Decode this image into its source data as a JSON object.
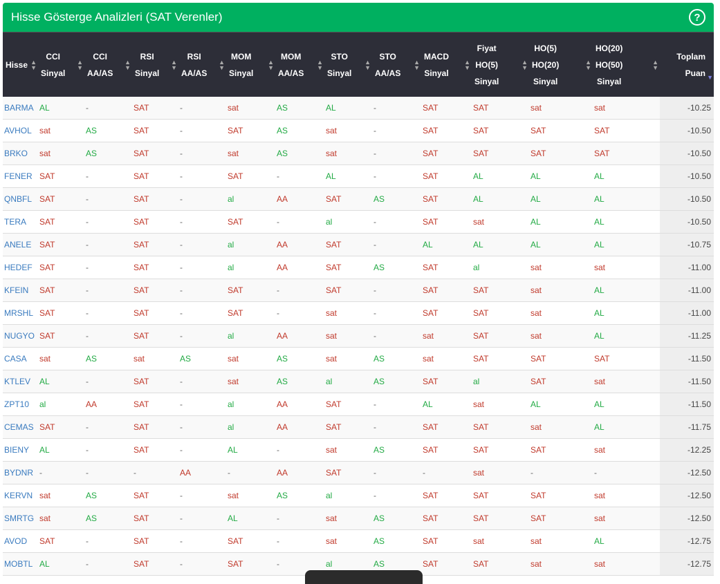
{
  "title": "Hisse Gösterge Analizleri (SAT Verenler)",
  "help_icon": "question-circle-icon",
  "colors": {
    "header_bar": "#00b060",
    "table_header": "#2d2e38",
    "buy": "#22aa44",
    "sell": "#c0392b",
    "stock_link": "#3a7bbf"
  },
  "columns": [
    [
      "Hisse"
    ],
    [
      "CCI",
      "Sinyal"
    ],
    [
      "CCI",
      "AA/AS"
    ],
    [
      "RSI",
      "Sinyal"
    ],
    [
      "RSI",
      "AA/AS"
    ],
    [
      "MOM",
      "Sinyal"
    ],
    [
      "MOM",
      "AA/AS"
    ],
    [
      "STO",
      "Sinyal"
    ],
    [
      "STO",
      "AA/AS"
    ],
    [
      "MACD",
      "Sinyal"
    ],
    [
      "Fiyat",
      "HO(5)",
      "Sinyal"
    ],
    [
      "HO(5)",
      "HO(20)",
      "Sinyal"
    ],
    [
      "HO(20)",
      "HO(50)",
      "Sinyal"
    ],
    [
      "Toplam",
      "Puan"
    ]
  ],
  "sorted_column": "Toplam Puan",
  "sort_direction": "descending",
  "rows": [
    [
      "BARMA",
      "AL",
      "-",
      "SAT",
      "-",
      "sat",
      "AS",
      "AL",
      "-",
      "SAT",
      "SAT",
      "sat",
      "sat",
      "-10.25"
    ],
    [
      "AVHOL",
      "sat",
      "AS",
      "SAT",
      "-",
      "SAT",
      "AS",
      "sat",
      "-",
      "SAT",
      "SAT",
      "SAT",
      "SAT",
      "-10.50"
    ],
    [
      "BRKO",
      "sat",
      "AS",
      "SAT",
      "-",
      "sat",
      "AS",
      "sat",
      "-",
      "SAT",
      "SAT",
      "SAT",
      "SAT",
      "-10.50"
    ],
    [
      "FENER",
      "SAT",
      "-",
      "SAT",
      "-",
      "SAT",
      "-",
      "AL",
      "-",
      "SAT",
      "AL",
      "AL",
      "AL",
      "-10.50"
    ],
    [
      "QNBFL",
      "SAT",
      "-",
      "SAT",
      "-",
      "al",
      "AA",
      "SAT",
      "AS",
      "SAT",
      "AL",
      "AL",
      "AL",
      "-10.50"
    ],
    [
      "TERA",
      "SAT",
      "-",
      "SAT",
      "-",
      "SAT",
      "-",
      "al",
      "-",
      "SAT",
      "sat",
      "AL",
      "AL",
      "-10.50"
    ],
    [
      "ANELE",
      "SAT",
      "-",
      "SAT",
      "-",
      "al",
      "AA",
      "SAT",
      "-",
      "AL",
      "AL",
      "AL",
      "AL",
      "-10.75"
    ],
    [
      "HEDEF",
      "SAT",
      "-",
      "SAT",
      "-",
      "al",
      "AA",
      "SAT",
      "AS",
      "SAT",
      "al",
      "sat",
      "sat",
      "-11.00"
    ],
    [
      "KFEIN",
      "SAT",
      "-",
      "SAT",
      "-",
      "SAT",
      "-",
      "SAT",
      "-",
      "SAT",
      "SAT",
      "sat",
      "AL",
      "-11.00"
    ],
    [
      "MRSHL",
      "SAT",
      "-",
      "SAT",
      "-",
      "SAT",
      "-",
      "sat",
      "-",
      "SAT",
      "SAT",
      "sat",
      "AL",
      "-11.00"
    ],
    [
      "NUGYO",
      "SAT",
      "-",
      "SAT",
      "-",
      "al",
      "AA",
      "sat",
      "-",
      "sat",
      "SAT",
      "sat",
      "AL",
      "-11.25"
    ],
    [
      "CASA",
      "sat",
      "AS",
      "sat",
      "AS",
      "sat",
      "AS",
      "sat",
      "AS",
      "sat",
      "SAT",
      "SAT",
      "SAT",
      "-11.50"
    ],
    [
      "KTLEV",
      "AL",
      "-",
      "SAT",
      "-",
      "sat",
      "AS",
      "al",
      "AS",
      "SAT",
      "al",
      "SAT",
      "sat",
      "-11.50"
    ],
    [
      "ZPT10",
      "al",
      "AA",
      "SAT",
      "-",
      "al",
      "AA",
      "SAT",
      "-",
      "AL",
      "sat",
      "AL",
      "AL",
      "-11.50"
    ],
    [
      "CEMAS",
      "SAT",
      "-",
      "SAT",
      "-",
      "al",
      "AA",
      "SAT",
      "-",
      "SAT",
      "SAT",
      "sat",
      "AL",
      "-11.75"
    ],
    [
      "BIENY",
      "AL",
      "-",
      "SAT",
      "-",
      "AL",
      "-",
      "sat",
      "AS",
      "SAT",
      "SAT",
      "SAT",
      "sat",
      "-12.25"
    ],
    [
      "BYDNR",
      "-",
      "-",
      "-",
      "AA",
      "-",
      "AA",
      "SAT",
      "-",
      "-",
      "sat",
      "-",
      "-",
      "-12.50"
    ],
    [
      "KERVN",
      "sat",
      "AS",
      "SAT",
      "-",
      "sat",
      "AS",
      "al",
      "-",
      "SAT",
      "SAT",
      "SAT",
      "sat",
      "-12.50"
    ],
    [
      "SMRTG",
      "sat",
      "AS",
      "SAT",
      "-",
      "AL",
      "-",
      "sat",
      "AS",
      "SAT",
      "SAT",
      "SAT",
      "sat",
      "-12.50"
    ],
    [
      "AVOD",
      "SAT",
      "-",
      "SAT",
      "-",
      "SAT",
      "-",
      "sat",
      "AS",
      "SAT",
      "sat",
      "sat",
      "AL",
      "-12.75"
    ],
    [
      "MOBTL",
      "AL",
      "-",
      "SAT",
      "-",
      "SAT",
      "-",
      "al",
      "AS",
      "SAT",
      "SAT",
      "sat",
      "sat",
      "-12.75"
    ]
  ]
}
